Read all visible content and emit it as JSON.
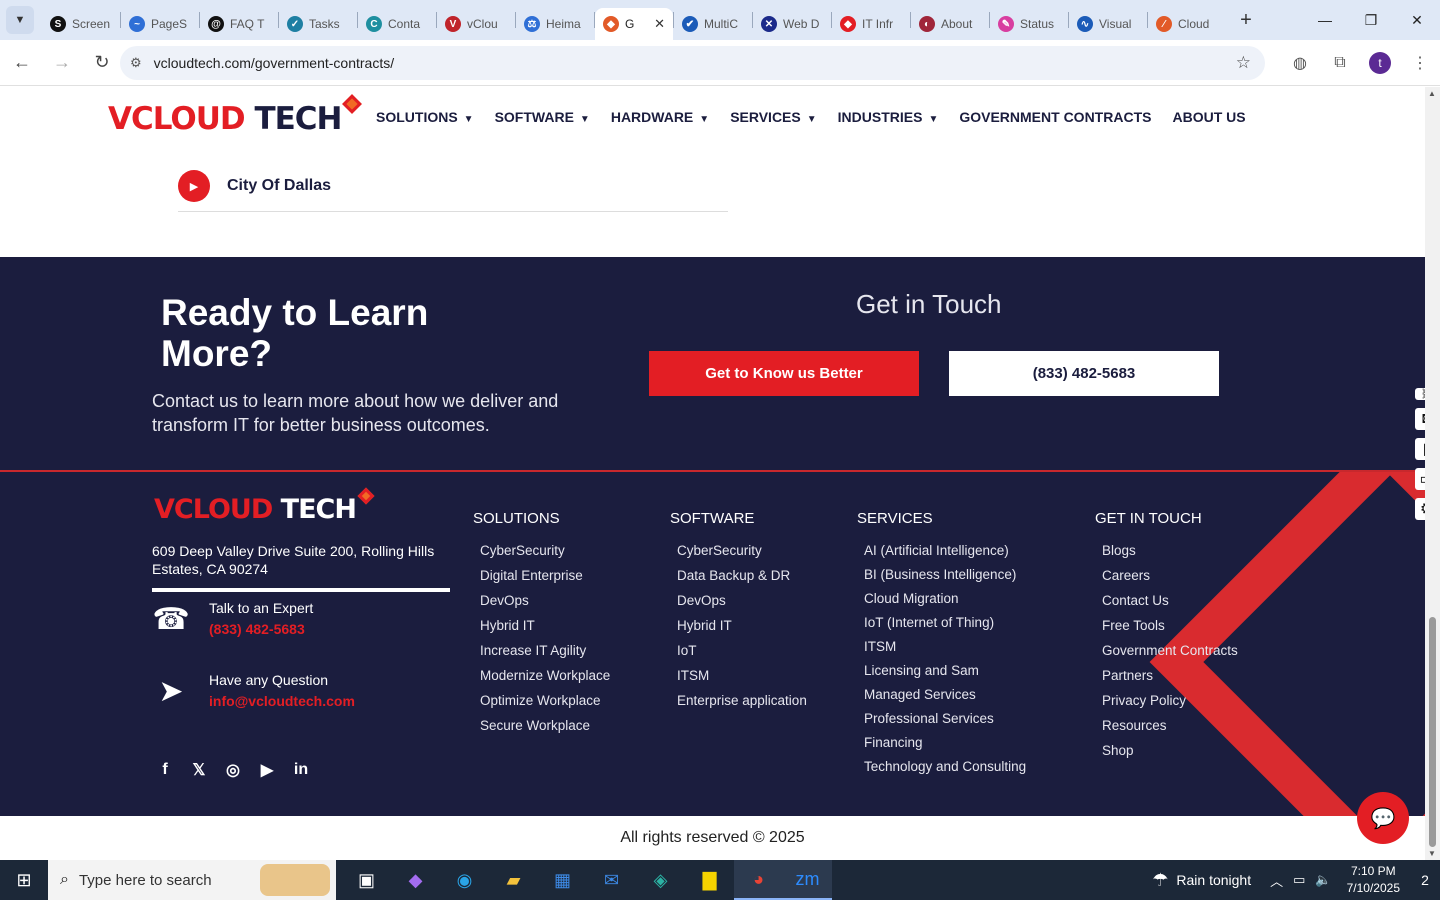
{
  "browser": {
    "tabs": [
      {
        "title": "Screen",
        "color": "#111111",
        "icon": "S"
      },
      {
        "title": "PageS",
        "color": "#2f6fd6",
        "icon": "~"
      },
      {
        "title": "FAQ T",
        "color": "#111111",
        "icon": "@"
      },
      {
        "title": "Tasks",
        "color": "#1e7fa3",
        "icon": "✓"
      },
      {
        "title": "Conta",
        "color": "#1e8fa0",
        "icon": "C"
      },
      {
        "title": "vClou",
        "color": "#c0242b",
        "icon": "V"
      },
      {
        "title": "Heima",
        "color": "#2f6fd6",
        "icon": "⚖"
      },
      {
        "title": "G",
        "color": "#e25a28",
        "icon": "◆"
      },
      {
        "title": "MultiC",
        "color": "#1b5bb8",
        "icon": "✔"
      },
      {
        "title": "Web D",
        "color": "#1b2a8a",
        "icon": "✕"
      },
      {
        "title": "IT Infr",
        "color": "#e31e24",
        "icon": "◆"
      },
      {
        "title": "About",
        "color": "#a0263a",
        "icon": "◐"
      },
      {
        "title": "Status",
        "color": "#d83ea0",
        "icon": "✎"
      },
      {
        "title": "Visual",
        "color": "#1b5bb8",
        "icon": "∿"
      },
      {
        "title": "Cloud",
        "color": "#e25a28",
        "icon": "⁄"
      }
    ],
    "url": "vcloudtech.com/government-contracts/",
    "avatar_letter": "t"
  },
  "header": {
    "logo_v": "V",
    "logo_rest": "CLOUD",
    "logo_tech": " TECH",
    "nav": [
      {
        "label": "SOLUTIONS",
        "caret": true
      },
      {
        "label": "SOFTWARE",
        "caret": true
      },
      {
        "label": "HARDWARE",
        "caret": true
      },
      {
        "label": "SERVICES",
        "caret": true
      },
      {
        "label": "INDUSTRIES",
        "caret": true
      },
      {
        "label": "GOVERNMENT CONTRACTS",
        "caret": false
      },
      {
        "label": "ABOUT US",
        "caret": false
      }
    ]
  },
  "list_item": {
    "label": "City Of Dallas"
  },
  "cta": {
    "heading": "Ready to Learn More?",
    "text": "Contact us to learn more about how we deliver and transform IT for better business outcomes.",
    "get_in_touch": "Get in Touch",
    "btn_primary": "Get to Know us Better",
    "btn_phone": "(833) 482-5683"
  },
  "footer": {
    "address": "609 Deep Valley Drive Suite 200, Rolling Hills Estates, CA 90274",
    "expert_label": "Talk to an Expert",
    "expert_phone": "(833) 482-5683",
    "question_label": "Have any Question",
    "question_email": "info@vcloudtech.com",
    "columns": [
      {
        "heading": "SOLUTIONS",
        "items": [
          "CyberSecurity",
          "Digital Enterprise",
          "DevOps",
          "Hybrid IT",
          "Increase IT Agility",
          "Modernize Workplace",
          "Optimize Workplace",
          "Secure Workplace"
        ]
      },
      {
        "heading": "SOFTWARE",
        "items": [
          "CyberSecurity",
          "Data Backup & DR",
          "DevOps",
          "Hybrid IT",
          "IoT",
          "ITSM",
          "Enterprise application"
        ]
      },
      {
        "heading": "SERVICES",
        "items": [
          "AI (Artificial Intelligence)",
          "BI (Business Intelligence)",
          "Cloud Migration",
          "IoT (Internet of Thing)",
          "ITSM",
          "Licensing and Sam",
          "Managed Services",
          "Professional Services",
          "Financing",
          "Technology and Consulting"
        ]
      },
      {
        "heading": "GET IN TOUCH",
        "items": [
          "Blogs",
          "Careers",
          "Contact Us",
          "Free Tools",
          "Government Contracts",
          "Partners",
          "Privacy Policy",
          "Resources",
          "Shop"
        ]
      }
    ],
    "copyright": "All rights reserved © 2025"
  },
  "taskbar": {
    "search_placeholder": "Type here to search",
    "weather": "Rain tonight",
    "time": "7:10 PM",
    "date": "7/10/2025",
    "notifications": "2"
  }
}
